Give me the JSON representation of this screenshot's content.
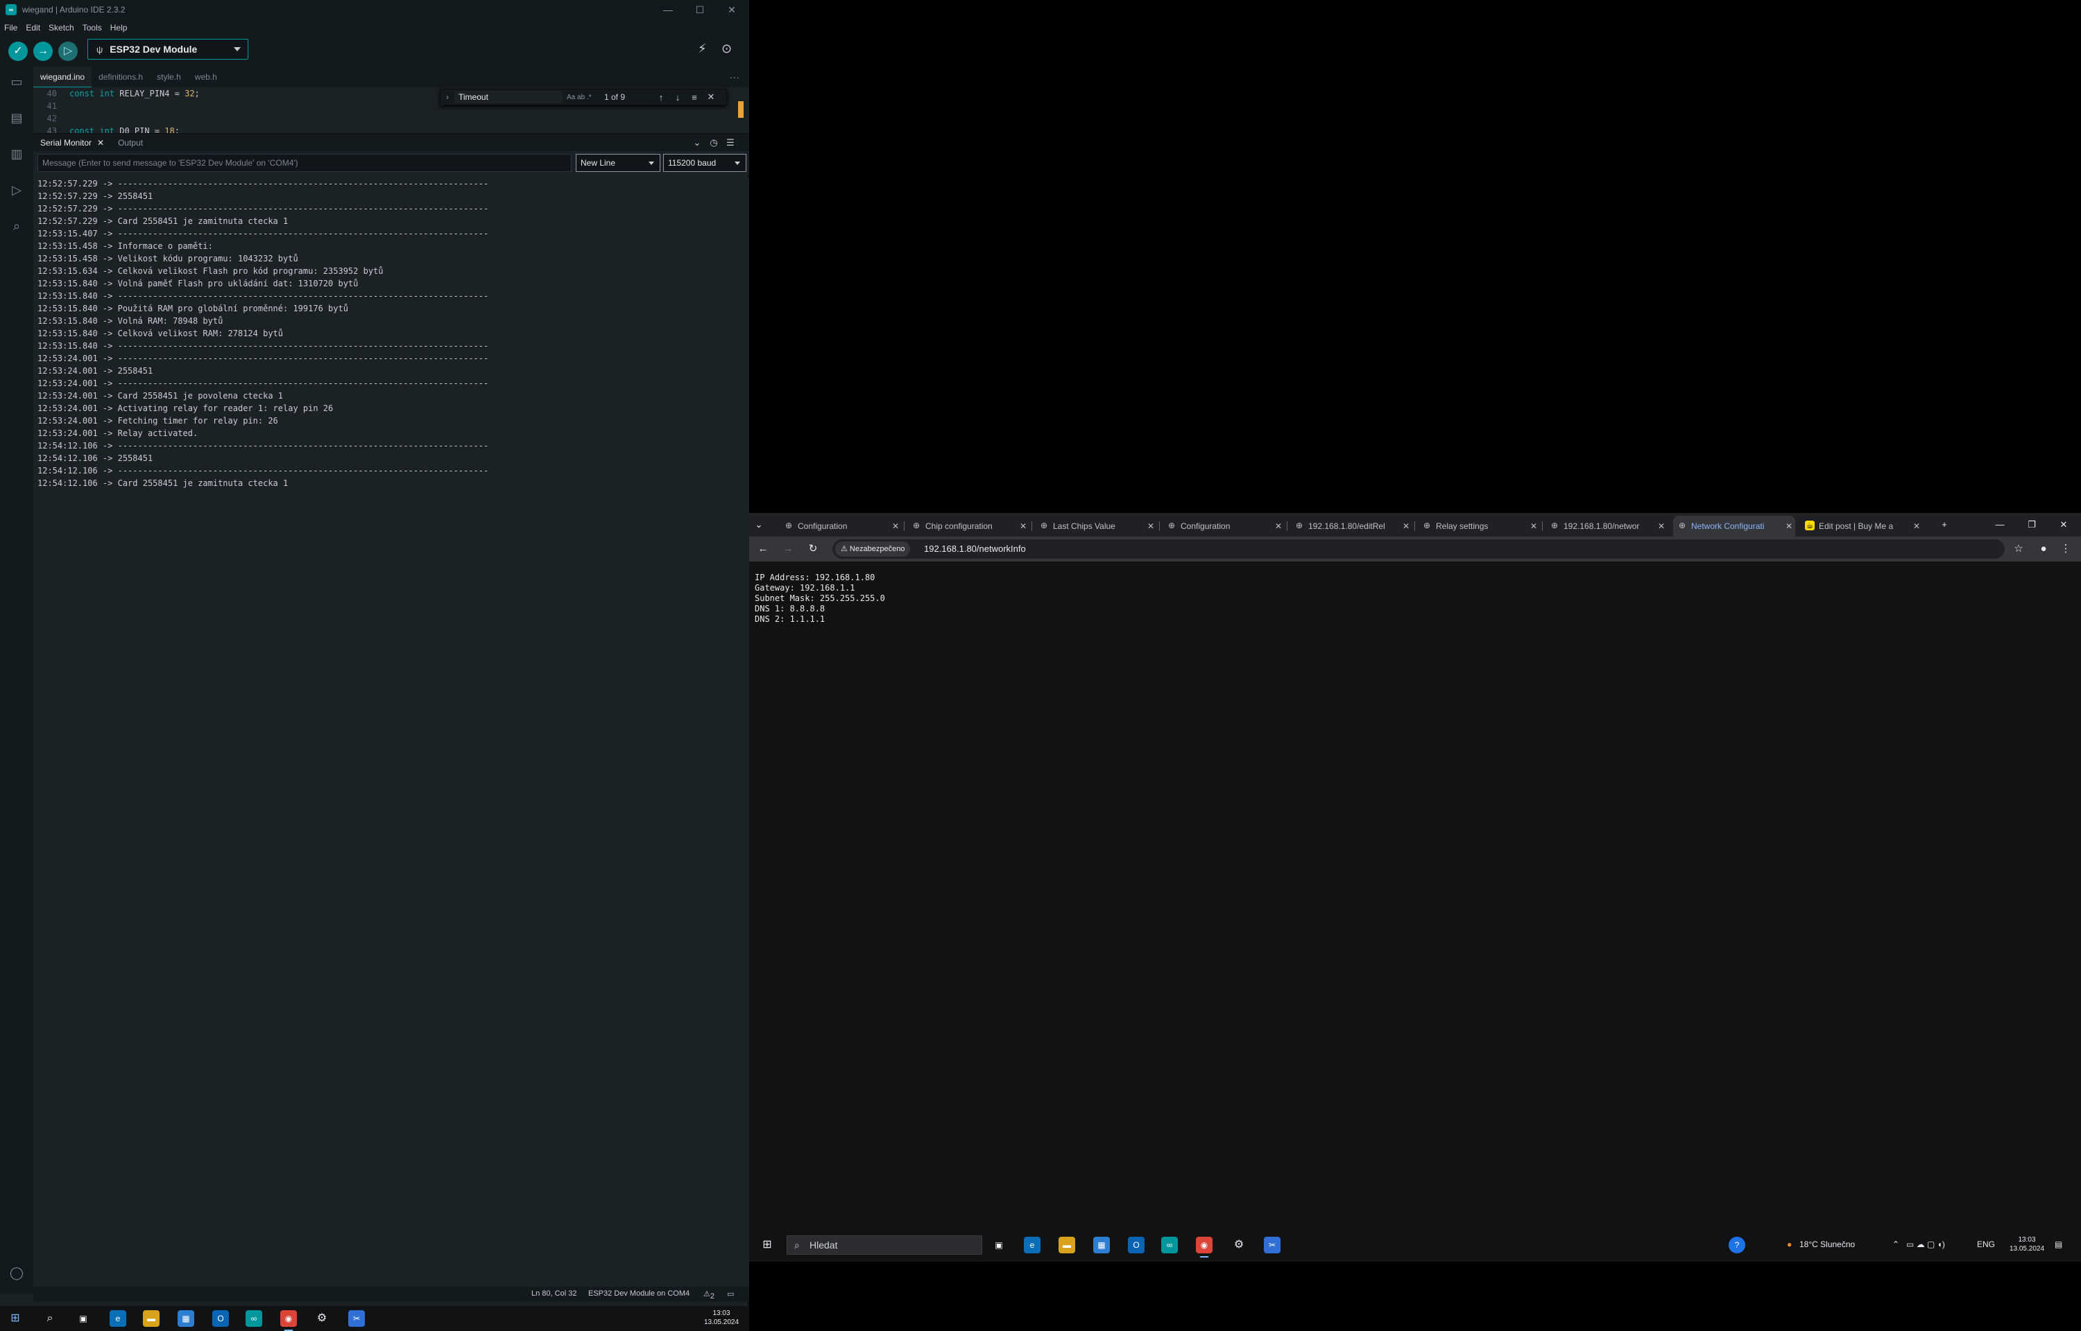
{
  "ide": {
    "title": "wiegand | Arduino IDE 2.3.2",
    "menu": [
      "File",
      "Edit",
      "Sketch",
      "Tools",
      "Help"
    ],
    "board": "ESP32 Dev Module",
    "file_tabs": [
      "wiegand.ino",
      "definitions.h",
      "style.h",
      "web.h"
    ],
    "editor_lines": [
      {
        "ln": "40",
        "kw": "const int",
        "rest": " RELAY_PIN4 = ",
        "num": "32",
        "end": ";"
      },
      {
        "ln": "41",
        "kw": "",
        "rest": "",
        "num": "",
        "end": ""
      },
      {
        "ln": "42",
        "kw": "",
        "rest": "",
        "num": "",
        "end": ""
      },
      {
        "ln": "43",
        "kw": "const int",
        "rest": " D0_PIN = ",
        "num": "18",
        "end": ";"
      }
    ],
    "find": {
      "query": "Timeout",
      "options": "Aa  ab  .*",
      "count": "1 of 9"
    },
    "panel_tabs": {
      "serial": "Serial Monitor",
      "output": "Output"
    },
    "serial_input_placeholder": "Message (Enter to send message to 'ESP32 Dev Module' on 'COM4')",
    "line_ending": "New Line",
    "baud": "115200 baud",
    "serial_lines": [
      "12:52:57.229 -> --------------------------------------------------------------------------",
      "12:52:57.229 -> 2558451",
      "12:52:57.229 -> --------------------------------------------------------------------------",
      "12:52:57.229 -> Card 2558451 je zamitnuta ctecka 1",
      "12:53:15.407 -> --------------------------------------------------------------------------",
      "12:53:15.458 -> Informace o paměti:",
      "12:53:15.458 -> Velikost kódu programu: 1043232 bytů",
      "12:53:15.634 -> Celková velikost Flash pro kód programu: 2353952 bytů",
      "12:53:15.840 -> Volná paměť Flash pro ukládání dat: 1310720 bytů",
      "12:53:15.840 -> --------------------------------------------------------------------------",
      "12:53:15.840 -> Použitá RAM pro globální proměnné: 199176 bytů",
      "12:53:15.840 -> Volná RAM: 78948 bytů",
      "12:53:15.840 -> Celková velikost RAM: 278124 bytů",
      "12:53:15.840 -> --------------------------------------------------------------------------",
      "12:53:24.001 -> --------------------------------------------------------------------------",
      "12:53:24.001 -> 2558451",
      "12:53:24.001 -> --------------------------------------------------------------------------",
      "12:53:24.001 -> Card 2558451 je povolena ctecka 1",
      "12:53:24.001 -> Activating relay for reader 1: relay pin 26",
      "12:53:24.001 -> Fetching timer for relay pin: 26",
      "12:53:24.001 -> Relay activated.",
      "12:54:12.106 -> --------------------------------------------------------------------------",
      "12:54:12.106 -> 2558451",
      "12:54:12.106 -> --------------------------------------------------------------------------",
      "12:54:12.106 -> Card 2558451 je zamitnuta ctecka 1"
    ],
    "status": {
      "position": "Ln 80, Col 32",
      "board_port": "ESP32 Dev Module on COM4",
      "notifications": "2"
    }
  },
  "left_taskbar": {
    "time": "13:03",
    "date": "13.05.2024"
  },
  "chrome": {
    "tabs": [
      {
        "label": "Configuration",
        "icon": "globe-icon",
        "active": false
      },
      {
        "label": "Chip configuration",
        "icon": "globe-icon",
        "active": false
      },
      {
        "label": "Last Chips Value",
        "icon": "globe-icon",
        "active": false
      },
      {
        "label": "Configuration",
        "icon": "globe-icon",
        "active": false
      },
      {
        "label": "192.168.1.80/editRel",
        "icon": "globe-icon",
        "active": false
      },
      {
        "label": "Relay settings",
        "icon": "globe-icon",
        "active": false
      },
      {
        "label": "192.168.1.80/networ",
        "icon": "globe-icon",
        "active": false
      },
      {
        "label": "Network Configurati",
        "icon": "globe-icon",
        "active": true
      },
      {
        "label": "Edit post | Buy Me a",
        "icon": "bmc-icon",
        "active": false
      }
    ],
    "security_chip": "Nezabezpečeno",
    "url": "192.168.1.80/networkInfo",
    "network_info": [
      "IP Address: 192.168.1.80",
      "Gateway: 192.168.1.1",
      "Subnet Mask: 255.255.255.0",
      "DNS 1: 8.8.8.8",
      "DNS 2: 1.1.1.1"
    ]
  },
  "right_taskbar": {
    "search_placeholder": "Hledat",
    "weather": "18°C  Slunečno",
    "language": "ENG",
    "time": "13:03",
    "date": "13.05.2024"
  },
  "colors": {
    "accent": "#00979c",
    "ide_bg": "#1b2226",
    "chrome_bg": "#121212"
  }
}
